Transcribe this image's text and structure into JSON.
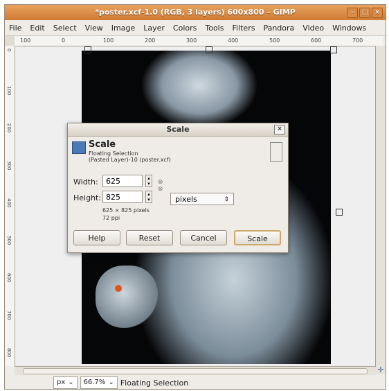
{
  "window": {
    "title": "*poster.xcf-1.0 (RGB, 3 layers) 600x800 – GIMP",
    "controls": [
      "–",
      "□",
      "×"
    ]
  },
  "menubar": [
    "File",
    "Edit",
    "Select",
    "View",
    "Image",
    "Layer",
    "Colors",
    "Tools",
    "Filters",
    "Pandora",
    "Video",
    "Windows"
  ],
  "ruler": {
    "h_ticks": [
      "100",
      "0",
      "100",
      "200",
      "300",
      "400",
      "500",
      "600",
      "700"
    ],
    "v_ticks": [
      "0",
      "100",
      "200",
      "300",
      "400",
      "500",
      "600",
      "700",
      "800"
    ]
  },
  "statusbar": {
    "unit": "px",
    "zoom": "66.7%",
    "message": "Floating Selection"
  },
  "dialog": {
    "title": "Scale",
    "heading": "Scale",
    "subtitle1": "Floating Selection",
    "subtitle2": "(Pasted Layer)-10 (poster.xcf)",
    "width_label": "Width:",
    "width_value": "625",
    "height_label": "Height:",
    "height_value": "825",
    "unit": "pixels",
    "size_info": "625 × 825 pixels",
    "res_info": "72 ppi",
    "buttons": {
      "help": "Help",
      "reset": "Reset",
      "cancel": "Cancel",
      "scale": "Scale"
    }
  },
  "colors": {
    "titlebar": "#d88a44",
    "accent": "#3c63a8"
  }
}
